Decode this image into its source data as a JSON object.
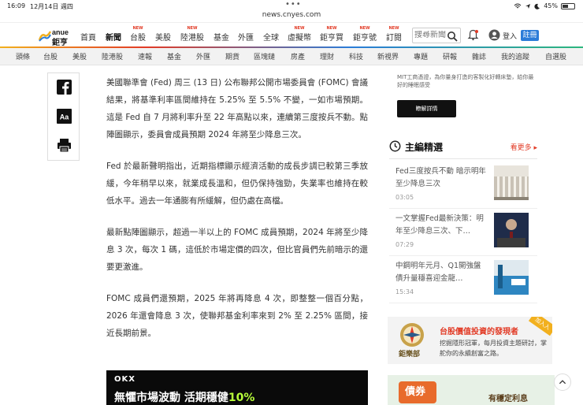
{
  "status_bar": {
    "time": "16:09",
    "date": "12月14日 週四",
    "dots": "•••",
    "url": "news.cnyes.com",
    "battery": "45%"
  },
  "brand": {
    "logo_top": "anue",
    "logo_bottom": "鉅亨"
  },
  "main_nav": {
    "items": [
      {
        "label": "首頁",
        "new": false
      },
      {
        "label": "新聞",
        "new": false,
        "active": true
      },
      {
        "label": "台股",
        "new": true
      },
      {
        "label": "美股",
        "new": false
      },
      {
        "label": "陸港股",
        "new": true
      },
      {
        "label": "基金",
        "new": false
      },
      {
        "label": "外匯",
        "new": false
      },
      {
        "label": "全球",
        "new": false
      },
      {
        "label": "虛擬幣",
        "new": true
      },
      {
        "label": "鉅亨買",
        "new": true
      },
      {
        "label": "鉅亨號",
        "new": true
      },
      {
        "label": "訂閱",
        "new": true
      }
    ],
    "new_tag": "NEW",
    "search_placeholder": "搜尋新聞",
    "login": "登入",
    "register": "註冊"
  },
  "sub_nav": [
    "頭條",
    "台股",
    "美股",
    "陸港股",
    "速報",
    "基金",
    "外匯",
    "期貨",
    "區塊鏈",
    "房產",
    "理財",
    "科技",
    "新視界",
    "專題",
    "研報",
    "雜誌",
    "我的追蹤",
    "自選股"
  ],
  "article": {
    "paragraphs": [
      "美國聯準會 (Fed) 周三 (13 日) 公布聯邦公開市場委員會 (FOMC) 會議結果，將基準利率區間維持在 5.25% 至 5.5% 不變，一如市場預期。這是 Fed 自 7 月將利率升至 22 年高點以來，連續第三度按兵不動。點陣圖顯示，委員會成員預期 2024 年將至少降息三次。",
      "Fed 於最新聲明指出，近期指標顯示經濟活動的成長步調已較第三季放緩，今年稍早以來，就業成長溫和，但仍保持強勁，失業率也維持在較低水平。過去一年通膨有所緩解，但仍處在高檔。",
      "最新點陣圖顯示，超過一半以上的 FOMC 成員預期，2024 年將至少降息 3 次，每次 1 碼，這低於市場定價的四次，但比官員們先前暗示的還要更激進。",
      "FOMC 成員們還預期，2025 年將再降息 4 次，即整整一個百分點，2026 年還會降息 3 次，使聯邦基金利率來到 2% 至 2.25% 區間，接近長期前景。"
    ],
    "ad": {
      "logo": "OKX",
      "text": "無懼市場波動  活期穩健",
      "highlight": "10%"
    }
  },
  "sidebar": {
    "promo": {
      "text": "MIT工商憑證，為你量身打造的客製化好轉床墊，給你最好的睡眠感受",
      "button": "瞭解詳情"
    },
    "section_title": "主編精選",
    "more": "看更多",
    "items": [
      {
        "title": "Fed三度按兵不動 暗示明年至少降息三次",
        "time": "03:05"
      },
      {
        "title": "一文掌握Fed最新決策：明年至少降息三次、下…",
        "time": "07:29"
      },
      {
        "title": "中鋼明年元月、Q1開強盤 債升量穩喜迎金龍…",
        "time": "15:34"
      }
    ],
    "banner1": {
      "title": "台股價值投資的發現者",
      "body": "挖掘隱形冠軍，每月投資主題研討，掌舵你的永續創富之路。",
      "brand": "鉅樂部",
      "ribbon": "加入入"
    },
    "banner2": {
      "badge": "債券",
      "sub": "有穩定利息"
    }
  },
  "colors": {
    "accent": "#e23b26",
    "link_blue": "#2b7cd8",
    "subnav_bg": "#f2f2f2"
  }
}
